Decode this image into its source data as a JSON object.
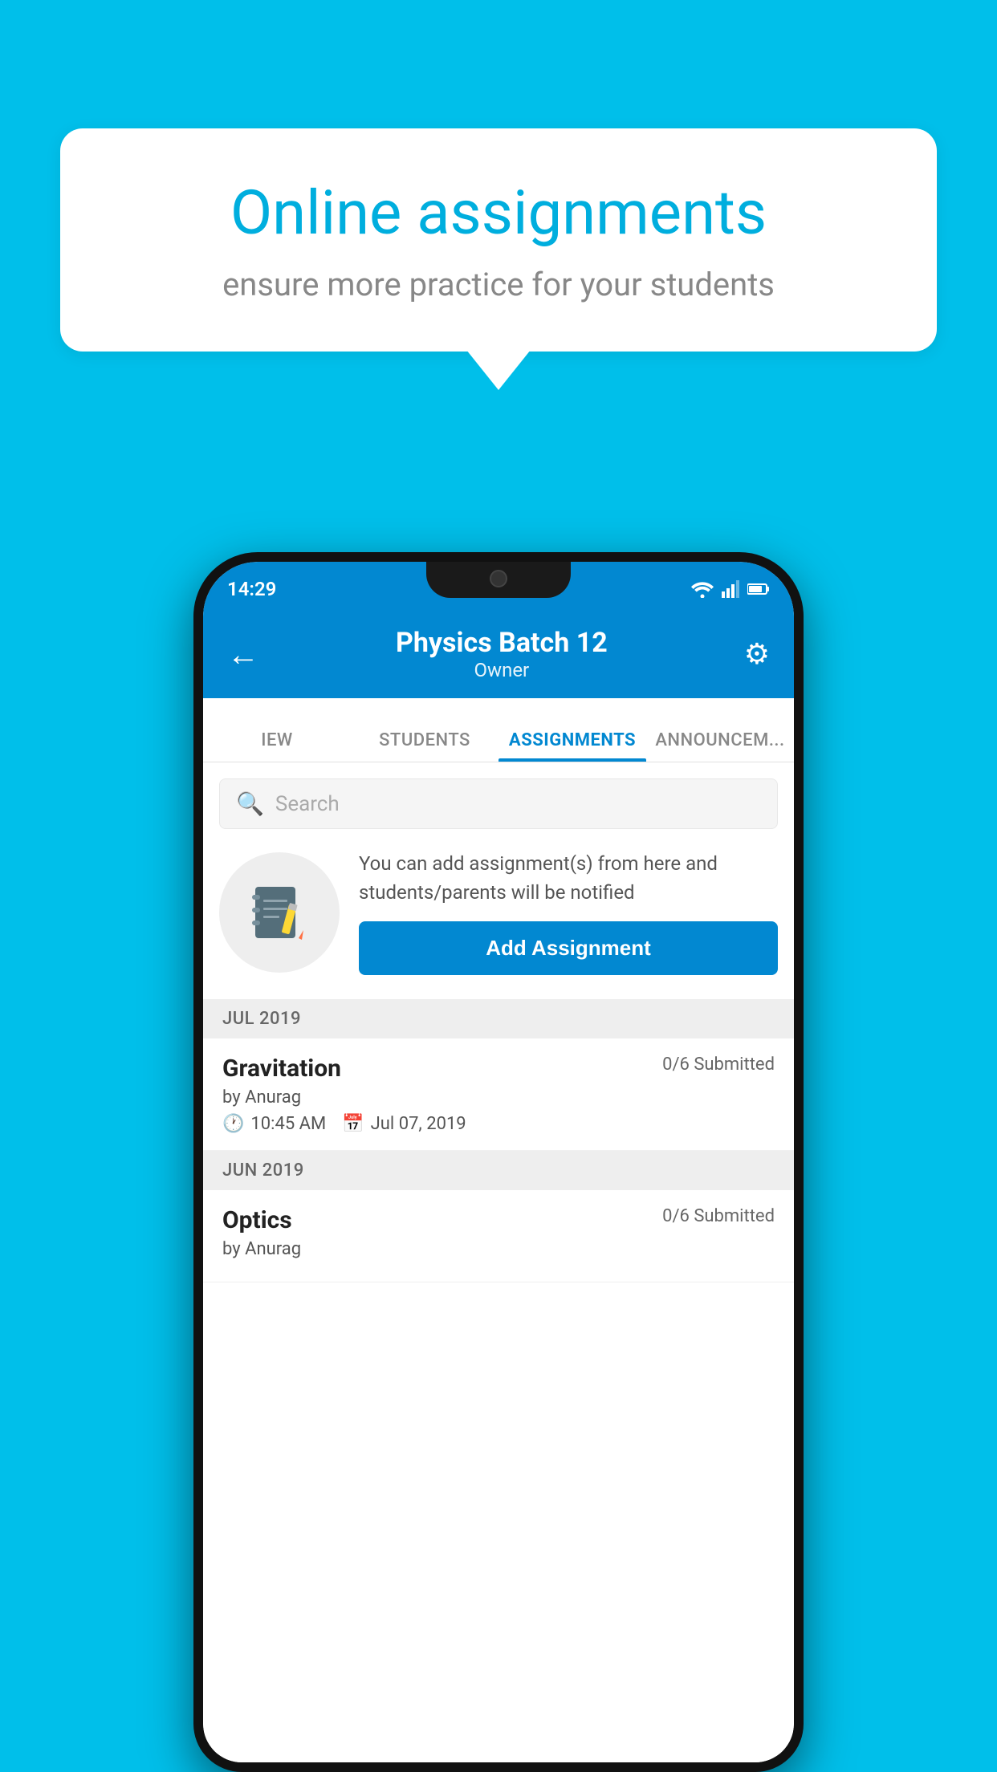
{
  "background_color": "#00BFEA",
  "speech_bubble": {
    "title": "Online assignments",
    "subtitle": "ensure more practice for your students"
  },
  "status_bar": {
    "time": "14:29"
  },
  "app_header": {
    "title": "Physics Batch 12",
    "subtitle": "Owner",
    "back_label": "←",
    "settings_label": "⚙"
  },
  "tabs": [
    {
      "label": "IEW",
      "active": false
    },
    {
      "label": "STUDENTS",
      "active": false
    },
    {
      "label": "ASSIGNMENTS",
      "active": true
    },
    {
      "label": "ANNOUNCEM...",
      "active": false
    }
  ],
  "search": {
    "placeholder": "Search"
  },
  "promo": {
    "text": "You can add assignment(s) from here and students/parents will be notified",
    "button_label": "Add Assignment"
  },
  "sections": [
    {
      "header": "JUL 2019",
      "assignments": [
        {
          "name": "Gravitation",
          "submitted": "0/6 Submitted",
          "by": "by Anurag",
          "time": "10:45 AM",
          "date": "Jul 07, 2019"
        }
      ]
    },
    {
      "header": "JUN 2019",
      "assignments": [
        {
          "name": "Optics",
          "submitted": "0/6 Submitted",
          "by": "by Anurag",
          "time": "",
          "date": ""
        }
      ]
    }
  ]
}
